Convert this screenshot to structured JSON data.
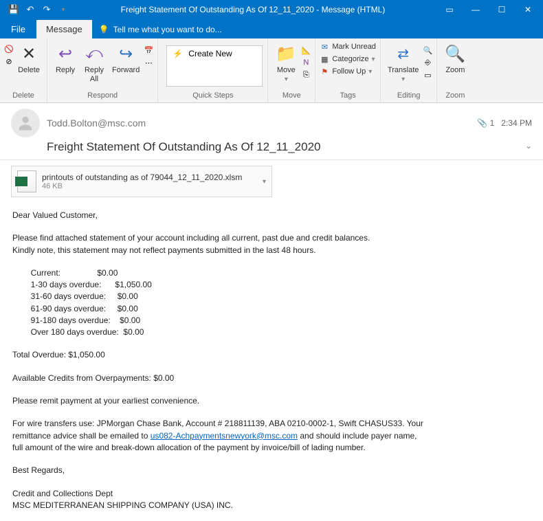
{
  "titlebar": {
    "title": "Freight Statement Of Outstanding As Of 12_11_2020 - Message (HTML)"
  },
  "tabs": {
    "file": "File",
    "message": "Message",
    "tellme": "Tell me what you want to do..."
  },
  "ribbon": {
    "delete": {
      "label": "Delete",
      "group": "Delete"
    },
    "reply": {
      "label": "Reply"
    },
    "replyall": {
      "label": "Reply\nAll"
    },
    "forward": {
      "label": "Forward"
    },
    "respond_group": "Respond",
    "create_new": "Create New",
    "quicksteps_group": "Quick Steps",
    "move": {
      "label": "Move"
    },
    "move_group": "Move",
    "mark_unread": "Mark Unread",
    "categorize": "Categorize",
    "followup": "Follow Up",
    "tags_group": "Tags",
    "translate": {
      "label": "Translate"
    },
    "editing_group": "Editing",
    "zoom": {
      "label": "Zoom"
    },
    "zoom_group": "Zoom"
  },
  "header": {
    "from": "Todd.Bolton@msc.com",
    "subject": "Freight Statement Of Outstanding As Of 12_11_2020",
    "time": "2:34 PM",
    "attach_count": "1"
  },
  "attachment": {
    "name": "printouts of outstanding as of 79044_12_11_2020.xlsm",
    "size": "46 KB"
  },
  "body": {
    "greeting": "Dear Valued Customer,",
    "p1": "Please find attached statement of your account including all current, past due and credit balances.",
    "p2": "Kindly note, this statement may not reflect payments submitted in the last 48 hours.",
    "r1": "        Current:                $0.00",
    "r2": "        1-30 days overdue:      $1,050.00",
    "r3": "        31-60 days overdue:     $0.00",
    "r4": "        61-90 days overdue:     $0.00",
    "r5": "        91-180 days overdue:    $0.00",
    "r6": "        Over 180 days overdue:  $0.00",
    "total": "Total Overdue: $1,050.00",
    "credits": "Available Credits from Overpayments: $0.00",
    "remit": "Please remit payment at your earliest convenience.",
    "wire1": "For wire transfers use: JPMorgan Chase Bank, Account # 218811139, ABA 0210-0002-1, Swift CHASUS33. Your",
    "wire2a": "remittance advice shall be emailed to ",
    "wire_email": "us082-Achpaymentsnewyork@msc.com",
    "wire2b": " and should include payer name,",
    "wire3": "full amount of the wire and break-down allocation of the payment by invoice/bill of lading number.",
    "regards": "Best Regards,",
    "dept": "Credit and Collections Dept",
    "company": "MSC MEDITERRANEAN SHIPPING COMPANY (USA) INC."
  }
}
